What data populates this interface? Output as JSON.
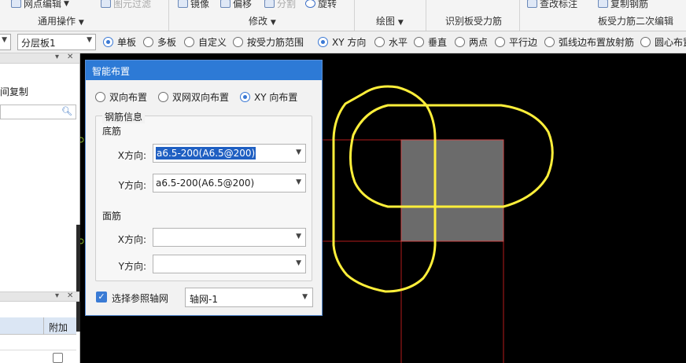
{
  "ribbon": {
    "top_items": {
      "mesh_edit": "网点编辑",
      "element_filter": "图元过滤",
      "mirror": "镜像",
      "offset": "偏移",
      "split": "分割",
      "rotate": "旋转",
      "view_annot": "查改标注",
      "copy_rebar": "复制钢筋"
    },
    "groups": {
      "general_ops": "通用操作",
      "modify": "修改",
      "draw": "绘图",
      "identify": "识别板受力筋",
      "secondary_edit": "板受力筋二次编辑"
    }
  },
  "options_bar": {
    "layer_combo": "分层板1",
    "layout_modes": [
      {
        "label": "单板",
        "selected": true
      },
      {
        "label": "多板",
        "selected": false
      },
      {
        "label": "自定义",
        "selected": false
      },
      {
        "label": "按受力筋范围",
        "selected": false
      }
    ],
    "direction_modes": [
      {
        "label": "XY 方向",
        "selected": true
      },
      {
        "label": "水平",
        "selected": false
      },
      {
        "label": "垂直",
        "selected": false
      },
      {
        "label": "两点",
        "selected": false
      },
      {
        "label": "平行边",
        "selected": false
      },
      {
        "label": "弧线边布置放射筋",
        "selected": false
      },
      {
        "label": "圆心布置",
        "selected": false
      }
    ]
  },
  "left_panel": {
    "tab_label": "间复制",
    "table_header": "附加"
  },
  "dialog": {
    "title": "智能布置",
    "modes": [
      {
        "label": "双向布置",
        "selected": false
      },
      {
        "label": "双网双向布置",
        "selected": false
      },
      {
        "label": "XY 向布置",
        "selected": true
      }
    ],
    "group_title": "钢筋信息",
    "bottom_section": "底筋",
    "top_section": "面筋",
    "bottom_x_label": "X方向:",
    "bottom_x_value": "a6.5-200(A6.5@200)",
    "bottom_y_label": "Y方向:",
    "bottom_y_value": "a6.5-200(A6.5@200)",
    "top_x_label": "X方向:",
    "top_x_value": "",
    "top_y_label": "Y方向:",
    "top_y_value": "",
    "ref_grid_label": "选择参照轴网",
    "ref_grid_checked": true,
    "ref_grid_value": "轴网-1"
  },
  "colors": {
    "dialog_title_bar": "#2d7ad6",
    "canvas_background": "#000000",
    "slab_outline": "#ffef3a",
    "slab_fill": "#6b6b6b",
    "guide_lines": "#b41c1c"
  }
}
